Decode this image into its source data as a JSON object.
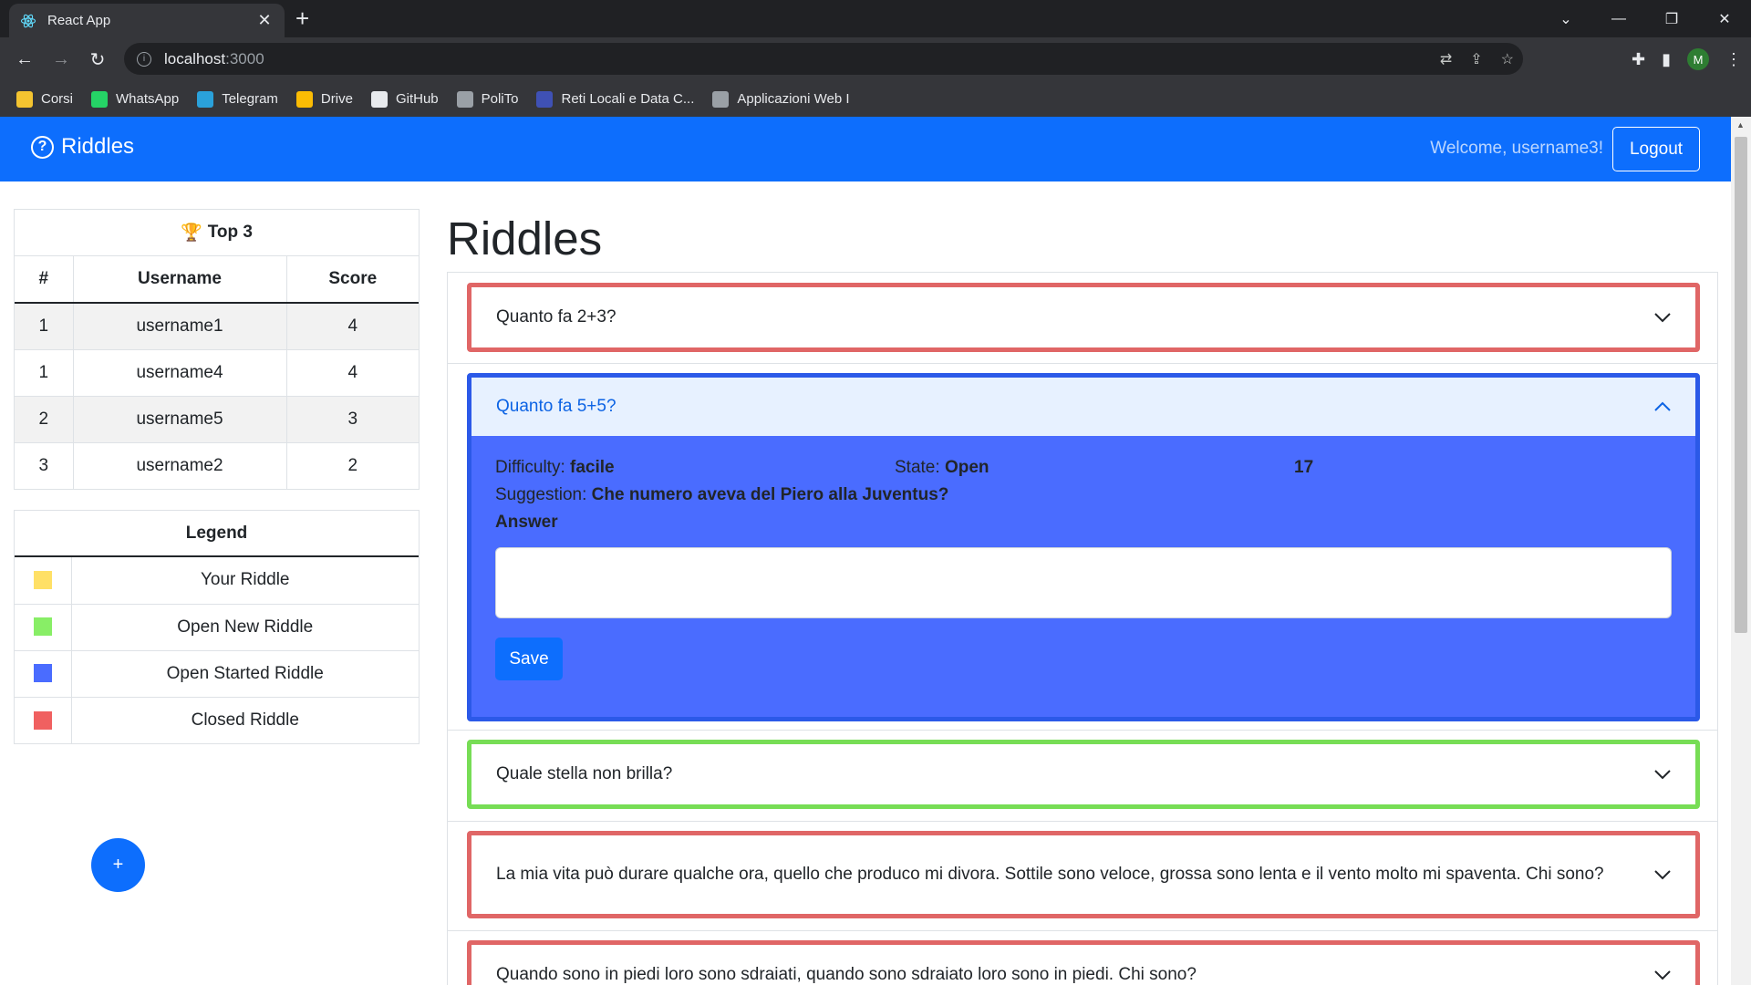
{
  "browser": {
    "tab_title": "React App",
    "url_host": "localhost",
    "url_port": ":3000",
    "profile_initial": "M",
    "bookmarks": [
      {
        "label": "Corsi",
        "color": "#f4c430"
      },
      {
        "label": "WhatsApp",
        "color": "#25d366"
      },
      {
        "label": "Telegram",
        "color": "#2aa1da"
      },
      {
        "label": "Drive",
        "color": "#fbbc04"
      },
      {
        "label": "GitHub",
        "color": "#e8eaed"
      },
      {
        "label": "PoliTo",
        "color": "#9aa0a6"
      },
      {
        "label": "Reti Locali e Data C...",
        "color": "#3f51b5"
      },
      {
        "label": "Applicazioni Web I",
        "color": "#9aa0a6"
      }
    ]
  },
  "navbar": {
    "brand": "Riddles",
    "welcome": "Welcome, username3!",
    "logout_label": "Logout",
    "color": "#0d6efd"
  },
  "leaderboard": {
    "title": "Top 3",
    "headers": [
      "#",
      "Username",
      "Score"
    ],
    "rows": [
      {
        "rank": "1",
        "username": "username1",
        "score": "4"
      },
      {
        "rank": "1",
        "username": "username4",
        "score": "4"
      },
      {
        "rank": "2",
        "username": "username5",
        "score": "3"
      },
      {
        "rank": "3",
        "username": "username2",
        "score": "2"
      }
    ]
  },
  "legend": {
    "title": "Legend",
    "items": [
      {
        "label": "Your Riddle",
        "color": "#ffe066"
      },
      {
        "label": "Open New Riddle",
        "color": "#88ee66"
      },
      {
        "label": "Open Started Riddle",
        "color": "#4a6cff"
      },
      {
        "label": "Closed Riddle",
        "color": "#f06060"
      }
    ]
  },
  "add_button_label": "+",
  "main": {
    "title": "Riddles",
    "riddles": [
      {
        "question": "Quanto fa 2+3?",
        "status": "closed"
      },
      {
        "question": "Quanto fa 5+5?",
        "status": "open-started",
        "expanded": true,
        "difficulty_label": "Difficulty:",
        "difficulty": "facile",
        "state_label": "State:",
        "state": "Open",
        "timer": "17",
        "suggestion_label": "Suggestion:",
        "suggestion": "Che numero aveva del Piero alla Juventus?",
        "answer_label": "Answer",
        "answer_value": "",
        "save_label": "Save"
      },
      {
        "question": "Quale stella non brilla?",
        "status": "open-new"
      },
      {
        "question": "La mia vita può durare qualche ora, quello che produco mi divora. Sottile sono veloce, grossa sono lenta e il vento molto mi spaventa. Chi sono?",
        "status": "closed"
      },
      {
        "question": "Quando sono in piedi loro sono sdraiati, quando sono sdraiato loro sono in piedi. Chi sono?",
        "status": "closed"
      }
    ]
  }
}
